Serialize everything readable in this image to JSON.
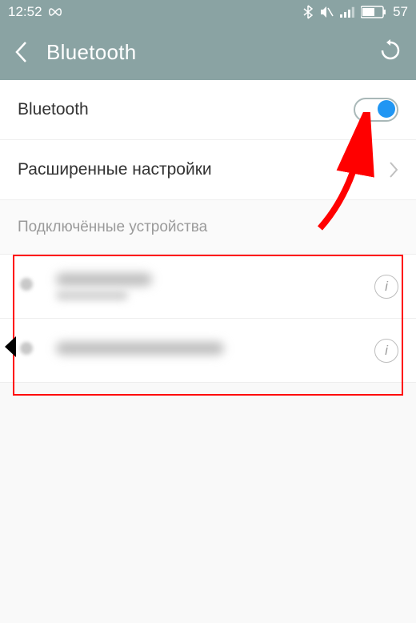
{
  "status": {
    "time": "12:52",
    "battery": "57"
  },
  "appbar": {
    "title": "Bluetooth"
  },
  "rows": {
    "bluetooth_label": "Bluetooth",
    "advanced_label": "Расширенные настройки"
  },
  "section": {
    "connected_devices": "Подключённые устройства"
  },
  "info_char": "i"
}
